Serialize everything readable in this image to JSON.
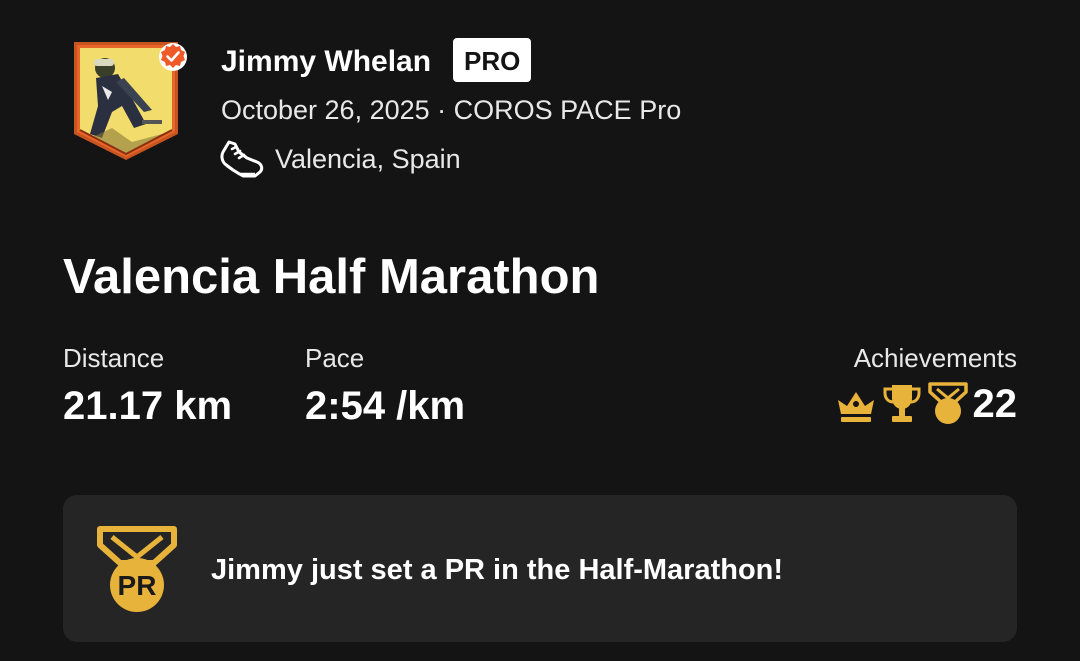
{
  "athlete": {
    "name": "Jimmy Whelan",
    "badge": "PRO",
    "date": "October 26, 2025",
    "separator": " · ",
    "device": "COROS PACE Pro",
    "location": "Valencia, Spain",
    "activity_type_icon": "running-shoe-icon",
    "verified_icon": "verified-check-icon"
  },
  "activity": {
    "title": "Valencia Half Marathon"
  },
  "stats": {
    "distance": {
      "label": "Distance",
      "value": "21.17 km"
    },
    "pace": {
      "label": "Pace",
      "value": "2:54 /km"
    },
    "achievements": {
      "label": "Achievements",
      "count": "22",
      "icons": [
        "crown-icon",
        "trophy-icon",
        "medal-icon"
      ]
    }
  },
  "pr_card": {
    "message": "Jimmy just set a PR in the Half-Marathon!",
    "medal_text": "PR",
    "icon": "pr-medal-icon"
  },
  "colors": {
    "background": "#141414",
    "card": "#252525",
    "gold": "#e8b33a",
    "verified": "#f05a28",
    "avatar_frame": "#e8662a"
  }
}
